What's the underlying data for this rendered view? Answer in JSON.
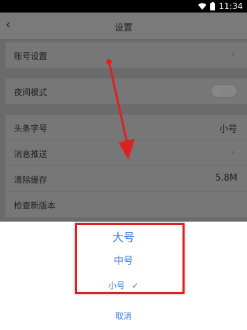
{
  "status": {
    "time": "11:34"
  },
  "nav": {
    "title": "设置"
  },
  "settings": {
    "account": {
      "label": "账号设置"
    },
    "night_mode": {
      "label": "夜间模式",
      "enabled": false
    },
    "font_size": {
      "label": "头条字号",
      "value": "小号"
    },
    "push": {
      "label": "消息推送"
    },
    "clear_cache": {
      "label": "清除缓存",
      "value": "5.8M"
    },
    "check_update": {
      "label": "检查新版本"
    }
  },
  "sheet": {
    "options": [
      "大号",
      "中号",
      "小号"
    ],
    "selected": "小号",
    "cancel": "取消"
  },
  "colors": {
    "accent": "#3d7bd9",
    "annotation": "#e02020"
  }
}
